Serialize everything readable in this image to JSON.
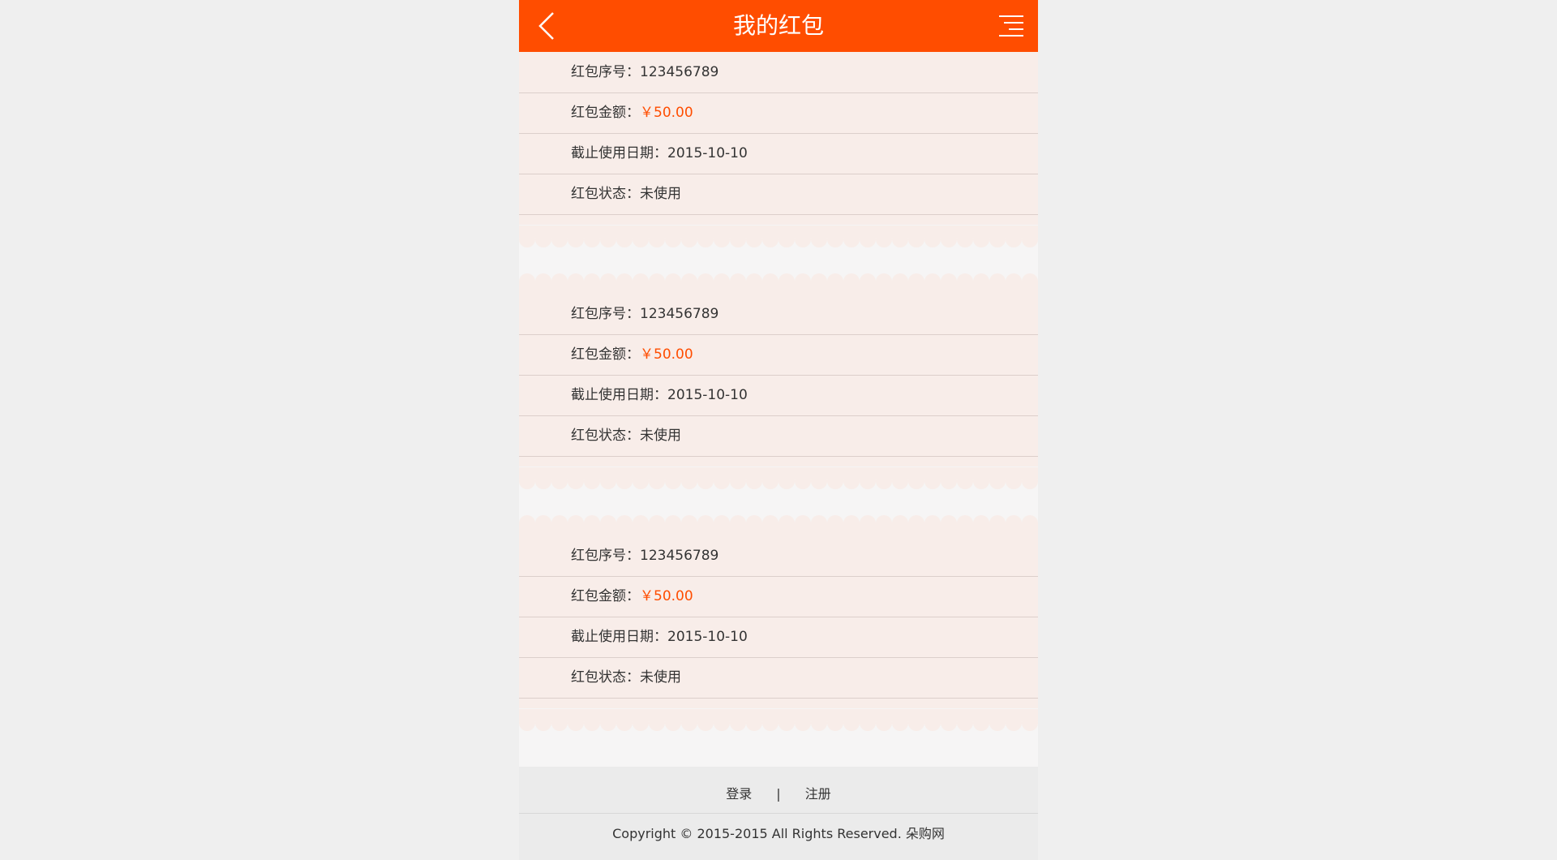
{
  "header": {
    "title": "我的红包",
    "back_icon": "chevron-left-icon",
    "menu_icon": "menu-icon"
  },
  "colors": {
    "accent": "#ff4d00",
    "card_bg": "#f8ede9",
    "page_bg": "#efefef"
  },
  "envelopes": [
    {
      "serial_label": "红包序号：",
      "serial_value": "123456789",
      "amount_label": "红包金额：",
      "amount_value": "￥50.00",
      "deadline_label": "截止使用日期：",
      "deadline_value": "2015-10-10",
      "status_label": "红包状态：",
      "status_value": "未使用"
    },
    {
      "serial_label": "红包序号：",
      "serial_value": "123456789",
      "amount_label": "红包金额：",
      "amount_value": "￥50.00",
      "deadline_label": "截止使用日期：",
      "deadline_value": "2015-10-10",
      "status_label": "红包状态：",
      "status_value": "未使用"
    },
    {
      "serial_label": "红包序号：",
      "serial_value": "123456789",
      "amount_label": "红包金额：",
      "amount_value": "￥50.00",
      "deadline_label": "截止使用日期：",
      "deadline_value": "2015-10-10",
      "status_label": "红包状态：",
      "status_value": "未使用"
    }
  ],
  "footer": {
    "login": "登录",
    "separator": "|",
    "register": "注册",
    "copyright": "Copyright © 2015-2015 All Rights Reserved. 朵购网"
  }
}
